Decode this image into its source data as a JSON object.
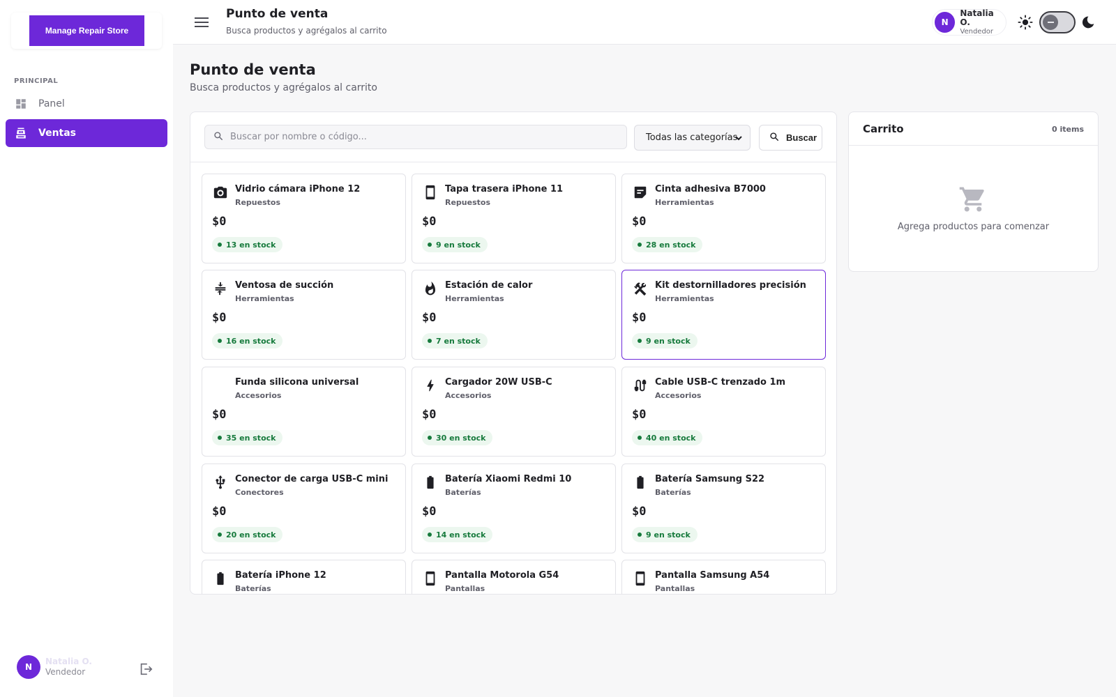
{
  "app": {
    "brand_button": "Manage Repair Store"
  },
  "sidebar": {
    "section_label": "PRINCIPAL",
    "items": [
      {
        "label": "Panel",
        "icon": "dashboard-icon",
        "active": false
      },
      {
        "label": "Ventas",
        "icon": "register-icon",
        "active": true
      }
    ],
    "user": {
      "initial": "N",
      "name": "Natalia O.",
      "role": "Vendedor"
    }
  },
  "header": {
    "title": "Punto de venta",
    "subtitle": "Busca productos y agrégalos al carrito",
    "user": {
      "initial": "N",
      "name": "Natalia O.",
      "role": "Vendedor"
    }
  },
  "page": {
    "title": "Punto de venta",
    "subtitle": "Busca productos y agrégalos al carrito"
  },
  "search": {
    "placeholder": "Buscar por nombre o código...",
    "value": "",
    "category_selected": "Todas las categorías",
    "button_label": "Buscar"
  },
  "products": [
    {
      "name": "Vidrio cámara iPhone 12",
      "category": "Repuestos",
      "price": "$0",
      "stock": "13 en stock",
      "icon": "camera-icon"
    },
    {
      "name": "Tapa trasera iPhone 11",
      "category": "Repuestos",
      "price": "$0",
      "stock": "9 en stock",
      "icon": "phone-icon"
    },
    {
      "name": "Cinta adhesiva B7000",
      "category": "Herramientas",
      "price": "$0",
      "stock": "28 en stock",
      "icon": "sticky-note-icon"
    },
    {
      "name": "Ventosa de succión",
      "category": "Herramientas",
      "price": "$0",
      "stock": "16 en stock",
      "icon": "compress-icon"
    },
    {
      "name": "Estación de calor",
      "category": "Herramientas",
      "price": "$0",
      "stock": "7 en stock",
      "icon": "fire-icon"
    },
    {
      "name": "Kit destornilladores precisión",
      "category": "Herramientas",
      "price": "$0",
      "stock": "9 en stock",
      "icon": "tools-icon",
      "selected": true
    },
    {
      "name": "Funda silicona universal",
      "category": "Accesorios",
      "price": "$0",
      "stock": "35 en stock",
      "icon": ""
    },
    {
      "name": "Cargador 20W USB-C",
      "category": "Accesorios",
      "price": "$0",
      "stock": "30 en stock",
      "icon": "bolt-icon"
    },
    {
      "name": "Cable USB-C trenzado 1m",
      "category": "Accesorios",
      "price": "$0",
      "stock": "40 en stock",
      "icon": "cable-icon"
    },
    {
      "name": "Conector de carga USB-C mini",
      "category": "Conectores",
      "price": "$0",
      "stock": "20 en stock",
      "icon": "usb-icon"
    },
    {
      "name": "Batería Xiaomi Redmi 10",
      "category": "Baterías",
      "price": "$0",
      "stock": "14 en stock",
      "icon": "battery-icon"
    },
    {
      "name": "Batería Samsung S22",
      "category": "Baterías",
      "price": "$0",
      "stock": "9 en stock",
      "icon": "battery-icon"
    },
    {
      "name": "Batería iPhone 12",
      "category": "Baterías",
      "price": "",
      "stock": "",
      "icon": "battery-icon"
    },
    {
      "name": "Pantalla Motorola G54",
      "category": "Pantallas",
      "price": "",
      "stock": "",
      "icon": "phone-icon"
    },
    {
      "name": "Pantalla Samsung A54",
      "category": "Pantallas",
      "price": "",
      "stock": "",
      "icon": "phone-icon"
    }
  ],
  "cart": {
    "title": "Carrito",
    "count": "0 items",
    "empty_message": "Agrega productos para comenzar"
  },
  "colors": {
    "accent": "#6d28d9",
    "stock_green": "#167a3c",
    "stock_bg": "#ecf7ef"
  }
}
